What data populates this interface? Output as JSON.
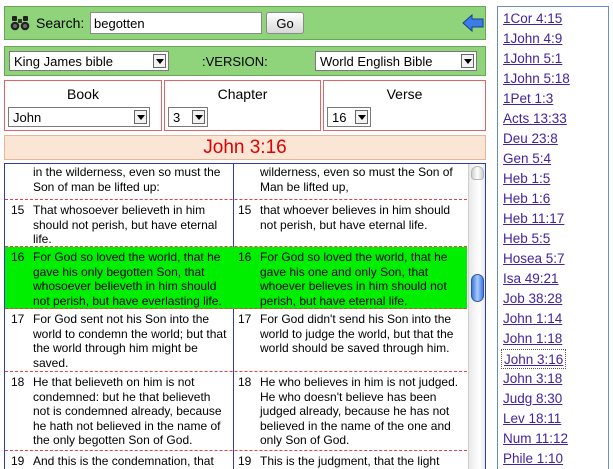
{
  "search": {
    "label": "Search:",
    "value": "begotten",
    "go_label": "Go"
  },
  "versions": {
    "left": "King James bible",
    "center_label": ":VERSION:",
    "right": "World English Bible"
  },
  "navigation": {
    "book_label": "Book",
    "book_value": "John",
    "chapter_label": "Chapter",
    "chapter_value": "3",
    "verse_label": "Verse",
    "verse_value": "16"
  },
  "reference_title": "John 3:16",
  "verses": [
    {
      "num": "",
      "left_text": "in the wilderness, even so must the Son of man be lifted up:",
      "right_text": "wilderness, even so must the Son of Man be lifted up,",
      "highlighted": false
    },
    {
      "num": "15",
      "left_text": "That whosoever believeth in him should not perish, but have eternal life.",
      "right_text": "that whoever believes in him should not perish, but have eternal life.",
      "highlighted": false
    },
    {
      "num": "16",
      "left_text": "For God so loved the world, that he gave his only begotten Son, that whosoever believeth in him should not perish, but have everlasting life.",
      "right_text": "For God so loved the world, that he gave his one and only Son, that whoever believes in him should not perish, but have eternal life.",
      "highlighted": true
    },
    {
      "num": "17",
      "left_text": "For God sent not his Son into the world to condemn the world; but that the world through him might be saved.",
      "right_text": "For God didn't send his Son into the world to judge the world, but that the world should be saved through him.",
      "highlighted": false
    },
    {
      "num": "18",
      "left_text": "He that believeth on him is not condemned: but he that believeth not is condemned already, because he hath not believed in the name of the only begotten Son of God.",
      "right_text": "He who believes in him is not judged. He who doesn't believe has been judged already, because he has not believed in the name of the one and only Son of God.",
      "highlighted": false
    },
    {
      "num": "19",
      "left_text": "And this is the condemnation, that",
      "right_text": "This is the judgment, that the light",
      "highlighted": false
    }
  ],
  "cross_references": [
    "1Cor 4:15",
    "1John 4:9",
    "1John 5:1",
    "1John 5:18",
    "1Pet 1:3",
    "Acts 13:33",
    "Deu 23:8",
    "Gen 5:4",
    "Heb 1:5",
    "Heb 1:6",
    "Heb 11:17",
    "Heb 5:5",
    "Hosea 5:7",
    "Isa 49:21",
    "Job 38:28",
    "John 1:14",
    "John 1:18",
    "John 3:16",
    "John 3:18",
    "Judg 8:30",
    "Lev 18:11",
    "Num 11:12",
    "Phile 1:10"
  ],
  "current_cross_reference": "John 3:16",
  "colors": {
    "panel_green": "#8fd37a",
    "highlight_green": "#00ee00",
    "reference_red": "#e00000",
    "link_purple": "#4422a0"
  },
  "icons": [
    "binoculars-icon",
    "back-arrow-icon",
    "chevron-down-icon"
  ]
}
